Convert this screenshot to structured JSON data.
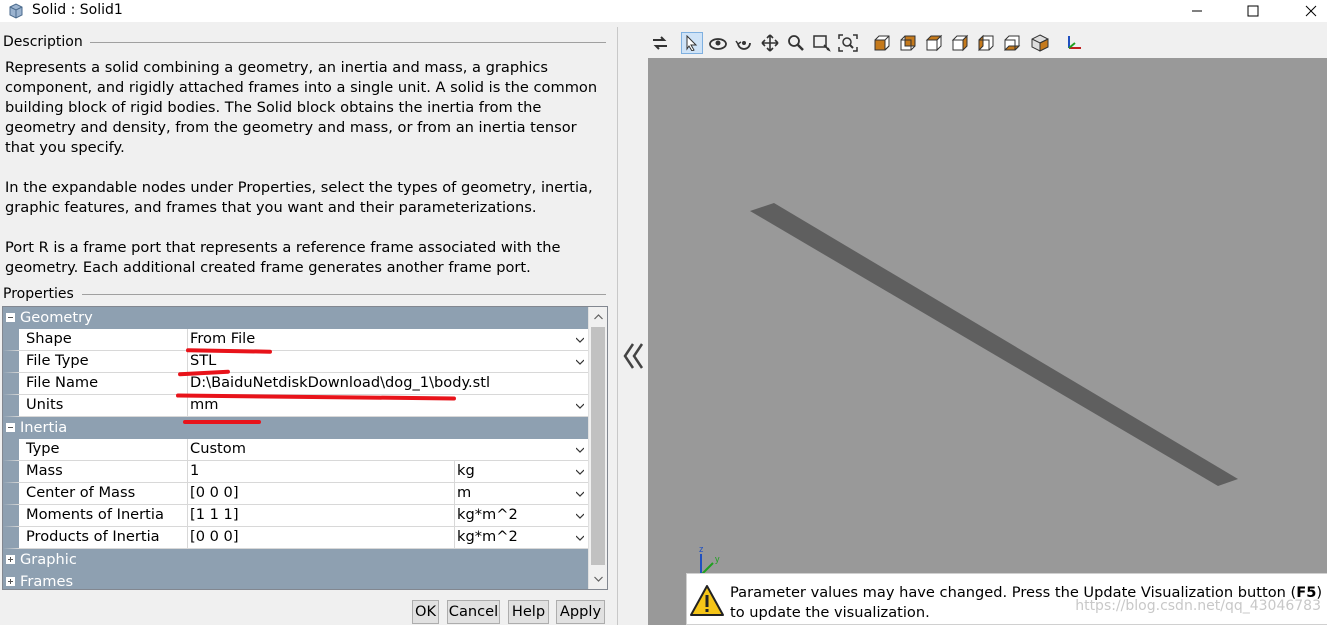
{
  "window": {
    "title": "Solid : Solid1"
  },
  "description": {
    "heading": "Description",
    "paragraphs": [
      "Represents a solid combining a geometry, an inertia and mass, a graphics component, and rigidly attached frames into a single unit. A solid is the common building block of rigid bodies. The Solid block obtains the inertia from the geometry and density, from the geometry and mass, or from an inertia tensor that you specify.",
      "In the expandable nodes under Properties, select the types of geometry, inertia, graphic features, and frames that you want and their parameterizations.",
      "Port R is a frame port that represents a reference frame associated with the geometry. Each additional created frame generates another frame port."
    ]
  },
  "properties": {
    "heading": "Properties",
    "geometry": {
      "label": "Geometry",
      "shape_label": "Shape",
      "shape_value": "From File",
      "filetype_label": "File Type",
      "filetype_value": "STL",
      "filename_label": "File Name",
      "filename_value": "D:\\BaiduNetdiskDownload\\dog_1\\body.stl",
      "units_label": "Units",
      "units_value": "mm"
    },
    "inertia": {
      "label": "Inertia",
      "type_label": "Type",
      "type_value": "Custom",
      "mass_label": "Mass",
      "mass_value": "1",
      "mass_unit": "kg",
      "com_label": "Center of Mass",
      "com_value": "[0 0 0]",
      "com_unit": "m",
      "moi_label": "Moments of Inertia",
      "moi_value": "[1 1 1]",
      "moi_unit": "kg*m^2",
      "poi_label": "Products of Inertia",
      "poi_value": "[0 0 0]",
      "poi_unit": "kg*m^2"
    },
    "graphic": {
      "label": "Graphic"
    },
    "frames": {
      "label": "Frames"
    }
  },
  "buttons": {
    "ok": "OK",
    "cancel": "Cancel",
    "help": "Help",
    "apply": "Apply"
  },
  "viewer": {
    "toolbar_icons": [
      "swap-icon",
      "select-icon",
      "rotate-icon",
      "roll-icon",
      "pan-icon",
      "zoom-icon",
      "zoom-box-icon",
      "fit-icon",
      "front-view-icon",
      "back-view-icon",
      "left-view-icon",
      "right-view-icon",
      "top-view-icon",
      "bottom-view-icon",
      "isometric-view-icon",
      "axes-icon"
    ],
    "collapse_icon": "chevrons-left-icon",
    "warning_text_before": "Parameter values may have changed. Press the Update Visualization button (",
    "warning_key": "F5",
    "warning_text_after": ") to update the visualization.",
    "watermark": "https://blog.csdn.net/qq_43046783",
    "triad_z": "z",
    "triad_y": "y"
  },
  "colors": {
    "category_header": "#8ea0b1",
    "viewport_bg": "#999999",
    "body_shape": "#5f5f5f",
    "annotation_marker": "#e8131a"
  }
}
